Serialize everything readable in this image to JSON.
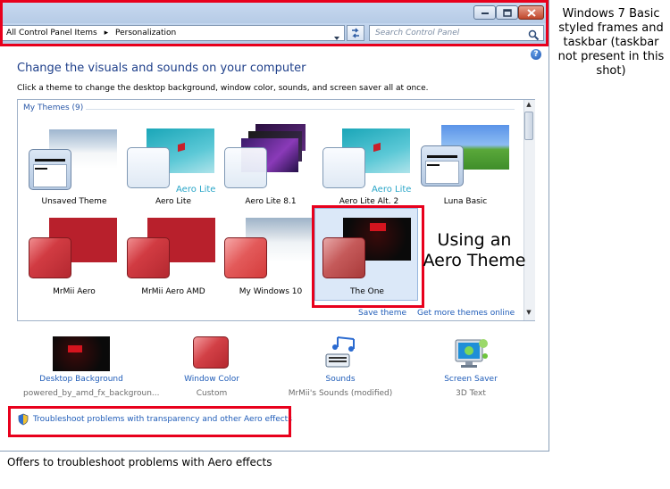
{
  "window": {
    "address": [
      "All Control Panel Items",
      "Personalization"
    ],
    "search_placeholder": "Search Control Panel"
  },
  "main": {
    "heading": "Change the visuals and sounds on your computer",
    "subheading": "Click a theme to change the desktop background, window color, sounds, and screen saver all at once."
  },
  "gallery": {
    "group_label": "My Themes (9)",
    "themes": [
      {
        "name": "Unsaved Theme"
      },
      {
        "name": "Aero Lite",
        "preview_text": "Aero Lite"
      },
      {
        "name": "Aero Lite 8.1"
      },
      {
        "name": "Aero Lite Alt. 2",
        "preview_text": "Aero Lite"
      },
      {
        "name": "Luna Basic"
      },
      {
        "name": "MrMii Aero"
      },
      {
        "name": "MrMii Aero AMD"
      },
      {
        "name": "My Windows 10"
      },
      {
        "name": "The One",
        "selected": true
      }
    ],
    "save_theme": "Save theme",
    "get_more": "Get more themes online"
  },
  "settings": [
    {
      "label": "Desktop Background",
      "value": "powered_by_amd_fx_backgroun..."
    },
    {
      "label": "Window Color",
      "value": "Custom"
    },
    {
      "label": "Sounds",
      "value": "MrMii's Sounds (modified)"
    },
    {
      "label": "Screen Saver",
      "value": "3D Text"
    }
  ],
  "troubleshoot_link": "Troubleshoot problems with transparency and other Aero effects",
  "annotations": {
    "right": "Windows 7 Basic styled frames and taskbar (taskbar not present in this shot)",
    "aero": "Using an Aero Theme",
    "bottom": "Offers to troubleshoot problems with Aero effects"
  },
  "colors": {
    "annotation_red": "#e8001c",
    "link_blue": "#1f5cb8",
    "heading_blue": "#1e3f8a",
    "titlebar": "#b6cbe6"
  },
  "icons": [
    "minimize-icon",
    "maximize-icon",
    "close-icon",
    "chevron-right-icon",
    "chevron-down-icon",
    "refresh-icon",
    "search-icon",
    "help-icon",
    "shield-icon",
    "sounds-icon",
    "screen-saver-icon"
  ]
}
